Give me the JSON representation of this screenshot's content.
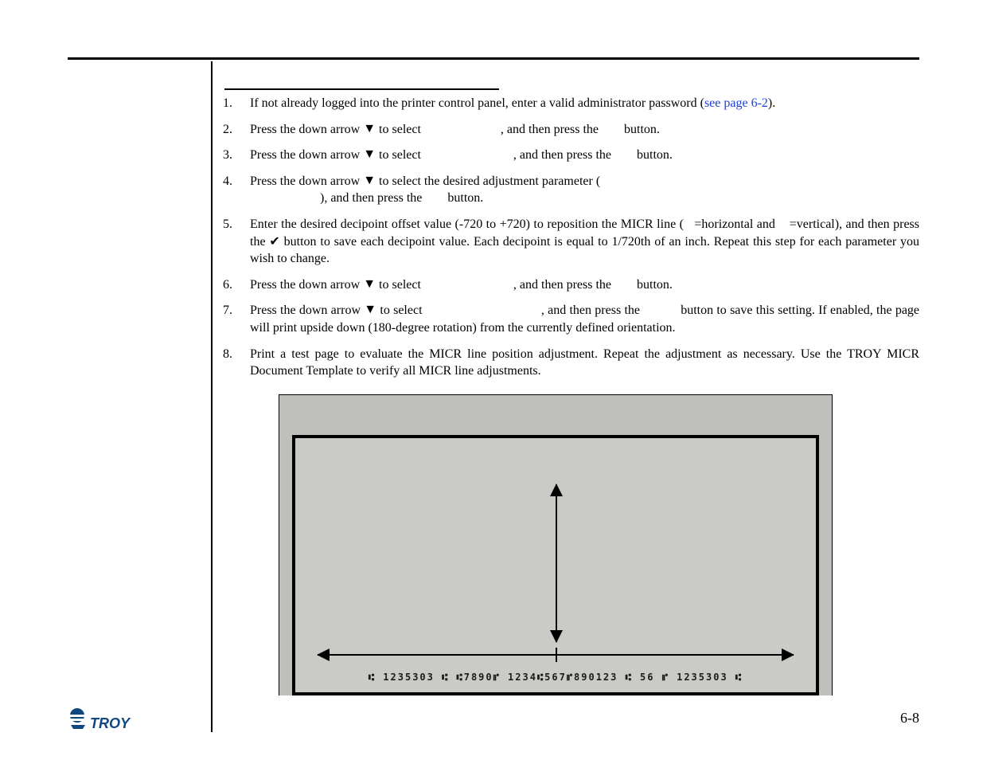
{
  "steps": {
    "s1_a": "If not already logged into the printer control panel, enter a valid administrator password (",
    "s1_link": "see page 6-2",
    "s1_b": ").",
    "s2_a": "Press the down arrow ",
    "s2_b": " to select ",
    "s2_c": ", and then press the ",
    "s2_d": "button.",
    "s3_a": "Press the down arrow ",
    "s3_b": " to select ",
    "s3_c": ", and then press the ",
    "s3_d": "button.",
    "s4_a": "Press the down arrow ",
    "s4_b": " to select the desired adjustment parameter (",
    "s4_c": "), and then press the ",
    "s4_d": "button.",
    "s5_a": "Enter the desired decipoint offset value (-720 to +720) to reposition the MICR line (",
    "s5_b": "=horizontal and ",
    "s5_c": "=vertical), and then press the ",
    "s5_d": " button to save each decipoint value.  Each decipoint is equal to 1/720th of an inch.  Repeat this step for each parameter you wish to change.",
    "s6_a": "Press the down arrow ",
    "s6_b": " to select ",
    "s6_c": ", and then press the ",
    "s6_d": "button.",
    "s7_a": "Press the down arrow ",
    "s7_b": " to select ",
    "s7_c": ", and then press the ",
    "s7_d": "button to save this setting.  If enabled, the page will print upside down (180-degree rotation) from the currently defined orientation.",
    "s8": "Print a test page to evaluate the MICR line position adjustment.  Repeat the adjustment as necessary.  Use the TROY MICR Document Template to verify all MICR line adjustments."
  },
  "nums": {
    "n1": "1.",
    "n2": "2.",
    "n3": "3.",
    "n4": "4.",
    "n5": "5.",
    "n6": "6.",
    "n7": "7.",
    "n8": "8."
  },
  "icons": {
    "down": "▼",
    "check": "✔"
  },
  "figure": {
    "micr_line": "⑆ 1235303 ⑆    ⑆7890⑈ 1234⑆567⑈890123 ⑆    56    ⑈ 1235303 ⑆"
  },
  "footer": {
    "page_number": "6-8",
    "logo_text": "TROY"
  }
}
